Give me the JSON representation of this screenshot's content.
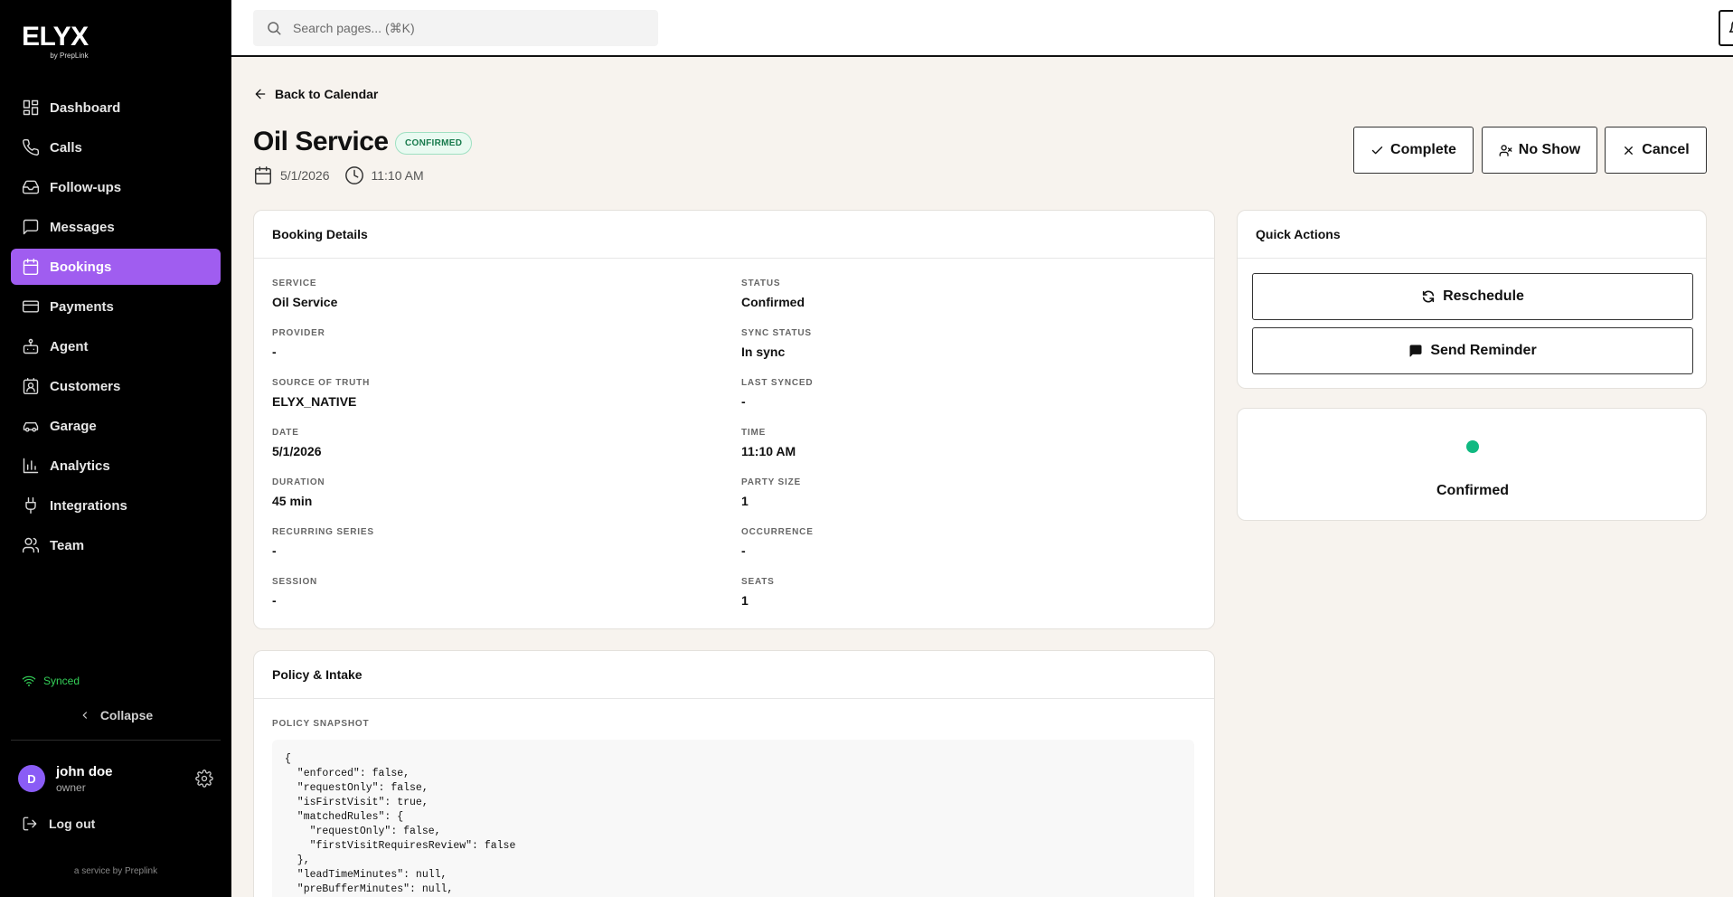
{
  "brand": {
    "logo": "ELYX",
    "sublogo": "by PrepLink"
  },
  "sidebar": {
    "items": [
      {
        "label": "Dashboard",
        "icon": "dashboard-icon"
      },
      {
        "label": "Calls",
        "icon": "phone-icon"
      },
      {
        "label": "Follow-ups",
        "icon": "inbox-icon"
      },
      {
        "label": "Messages",
        "icon": "message-icon"
      },
      {
        "label": "Bookings",
        "icon": "calendar-icon",
        "active": true
      },
      {
        "label": "Payments",
        "icon": "credit-card-icon"
      },
      {
        "label": "Agent",
        "icon": "bot-icon"
      },
      {
        "label": "Customers",
        "icon": "contact-icon"
      },
      {
        "label": "Garage",
        "icon": "car-icon"
      },
      {
        "label": "Analytics",
        "icon": "chart-icon"
      },
      {
        "label": "Integrations",
        "icon": "plug-icon"
      },
      {
        "label": "Team",
        "icon": "users-icon"
      }
    ],
    "sync_status": "Synced",
    "collapse_label": "Collapse",
    "user": {
      "initial": "D",
      "name": "john doe",
      "role": "owner"
    },
    "logout_label": "Log out",
    "footer": "a service by Preplink"
  },
  "topbar": {
    "search_placeholder": "Search pages... (⌘K)"
  },
  "header": {
    "back_label": "Back to Calendar",
    "title": "Oil Service",
    "status_badge": "CONFIRMED",
    "date": "5/1/2026",
    "time": "11:10 AM",
    "actions": {
      "complete": "Complete",
      "no_show": "No Show",
      "cancel": "Cancel"
    }
  },
  "booking_details": {
    "title": "Booking Details",
    "fields": [
      {
        "label": "SERVICE",
        "value": "Oil Service"
      },
      {
        "label": "STATUS",
        "value": "Confirmed"
      },
      {
        "label": "PROVIDER",
        "value": "-"
      },
      {
        "label": "SYNC STATUS",
        "value": "In sync"
      },
      {
        "label": "SOURCE OF TRUTH",
        "value": "ELYX_NATIVE"
      },
      {
        "label": "LAST SYNCED",
        "value": "-"
      },
      {
        "label": "DATE",
        "value": "5/1/2026"
      },
      {
        "label": "TIME",
        "value": "11:10 AM"
      },
      {
        "label": "DURATION",
        "value": "45 min"
      },
      {
        "label": "PARTY SIZE",
        "value": "1"
      },
      {
        "label": "RECURRING SERIES",
        "value": "-"
      },
      {
        "label": "OCCURRENCE",
        "value": "-"
      },
      {
        "label": "SESSION",
        "value": "-"
      },
      {
        "label": "SEATS",
        "value": "1"
      }
    ]
  },
  "policy": {
    "title": "Policy & Intake",
    "snapshot_label": "POLICY SNAPSHOT",
    "snapshot_code": "{\n  \"enforced\": false,\n  \"requestOnly\": false,\n  \"isFirstVisit\": true,\n  \"matchedRules\": {\n    \"requestOnly\": false,\n    \"firstVisitRequiresReview\": false\n  },\n  \"leadTimeMinutes\": null,\n  \"preBufferMinutes\": null,"
  },
  "quick_actions": {
    "title": "Quick Actions",
    "reschedule": "Reschedule",
    "send_reminder": "Send Reminder"
  },
  "status_card": {
    "label": "Confirmed",
    "color": "#10b981"
  }
}
